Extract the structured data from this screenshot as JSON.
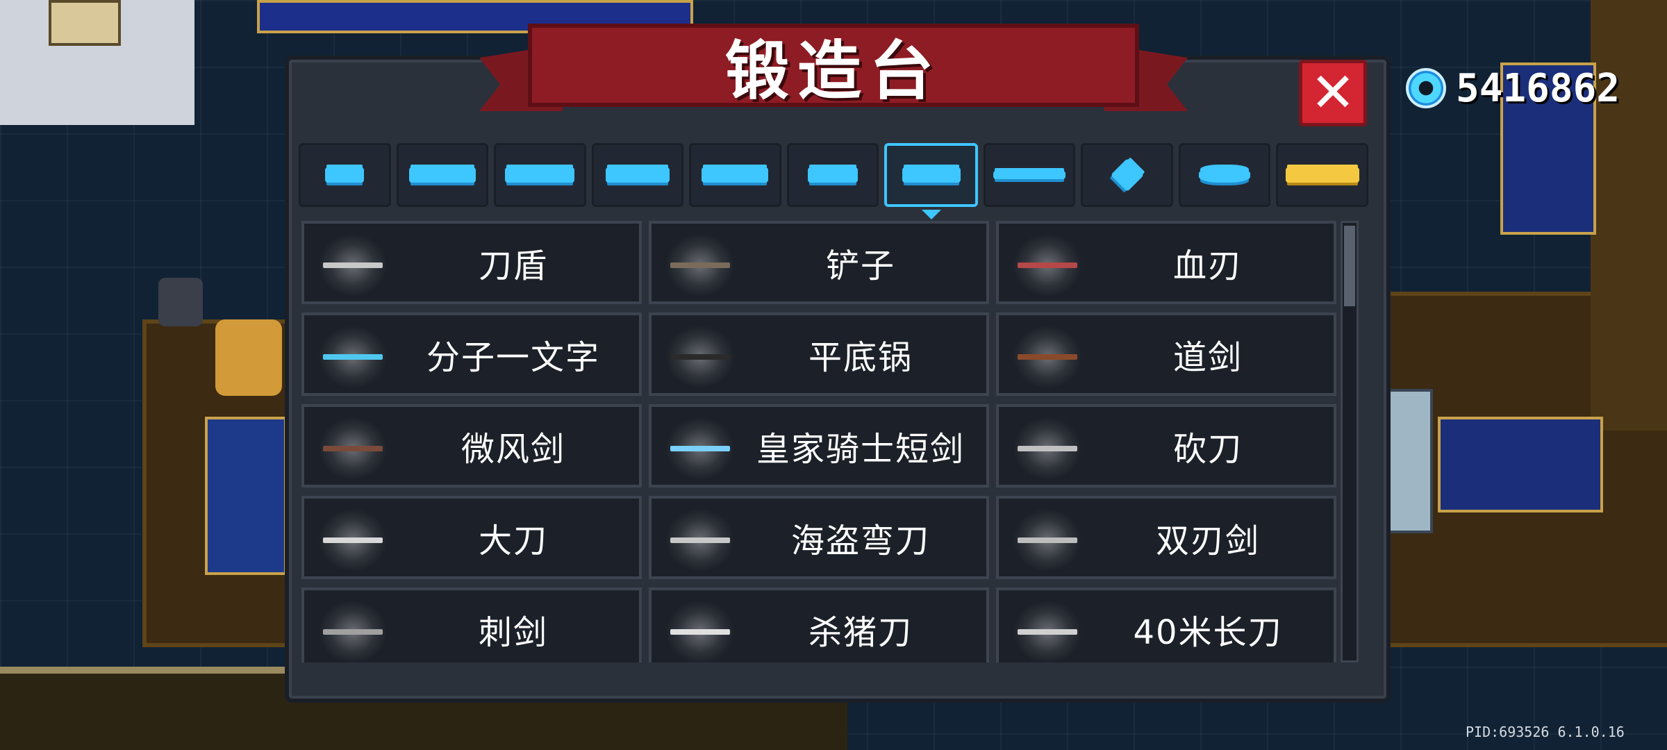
{
  "title": "锻造台",
  "close_label": "✕",
  "currency": {
    "icon": "gem-icon",
    "value": "5416862",
    "color": "#4fd8ff"
  },
  "tabs": [
    {
      "icon": "pistol-icon",
      "active": false
    },
    {
      "icon": "assault-rifle-icon",
      "active": false
    },
    {
      "icon": "shotgun-icon",
      "active": false
    },
    {
      "icon": "launcher-icon",
      "active": false
    },
    {
      "icon": "laser-gun-icon",
      "active": false
    },
    {
      "icon": "bow-icon",
      "active": false
    },
    {
      "icon": "sword-icon",
      "active": true
    },
    {
      "icon": "spear-icon",
      "active": false
    },
    {
      "icon": "shuriken-icon",
      "active": false
    },
    {
      "icon": "fish-icon",
      "active": false
    },
    {
      "icon": "crown-icon",
      "active": false
    }
  ],
  "items": [
    {
      "name": "刀盾",
      "color": "#c9c9c9"
    },
    {
      "name": "铲子",
      "color": "#7a6b5a"
    },
    {
      "name": "血刃",
      "color": "#b54848"
    },
    {
      "name": "分子一文字",
      "color": "#4fc8f0"
    },
    {
      "name": "平底锅",
      "color": "#2a2a2a"
    },
    {
      "name": "道剑",
      "color": "#8a4a2a"
    },
    {
      "name": "微风剑",
      "color": "#7a4a3a"
    },
    {
      "name": "皇家骑士短剑",
      "color": "#7ad0ff"
    },
    {
      "name": "砍刀",
      "color": "#c0c0c0"
    },
    {
      "name": "大刀",
      "color": "#d8d8d8"
    },
    {
      "name": "海盗弯刀",
      "color": "#c8c8c8"
    },
    {
      "name": "双刃剑",
      "color": "#bdbdbd"
    },
    {
      "name": "刺剑",
      "color": "#a0a0a0"
    },
    {
      "name": "杀猪刀",
      "color": "#e0e0e0"
    },
    {
      "name": "40米长刀",
      "color": "#d0d0d0"
    }
  ],
  "footer": {
    "pid": "PID:693526 6.1.0.16"
  }
}
